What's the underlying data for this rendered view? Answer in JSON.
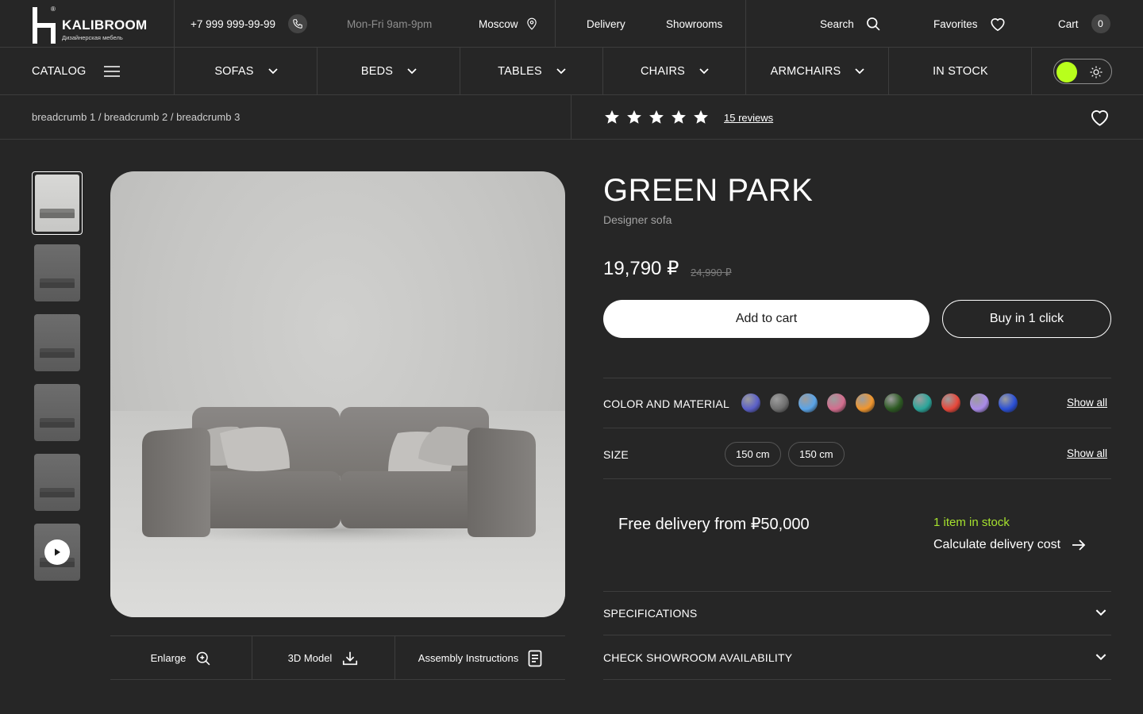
{
  "brand": {
    "name": "KALIBROOM",
    "tagline": "Дизайнерская мебель",
    "trademark": "®"
  },
  "header": {
    "phone": "+7 999 999-99-99",
    "hours": "Mon-Fri 9am-9pm",
    "city": "Moscow",
    "links": [
      "Delivery",
      "Showrooms"
    ],
    "search_label": "Search",
    "favorites_label": "Favorites",
    "cart_label": "Cart",
    "cart_count": "0"
  },
  "nav": {
    "catalog": "CATALOG",
    "categories": [
      "SOFAS",
      "BEDS",
      "TABLES",
      "CHAIRS",
      "ARMCHAIRS"
    ],
    "in_stock": "IN STOCK"
  },
  "theme": {
    "accent": "#b8ff1c",
    "in_stock_color": "#a6e22e"
  },
  "breadcrumb": "breadcrumb 1 / breadcrumb 2 / breadcrumb 3",
  "rating": {
    "stars": 5,
    "reviews": "15 reviews"
  },
  "product": {
    "title": "GREEN PARK",
    "subtitle": "Designer sofa",
    "price": "19,790 ₽",
    "old_price": "24,990 ₽",
    "add_to_cart": "Add to cart",
    "buy_one_click": "Buy in 1 click",
    "color_label": "COLOR AND MATERIAL",
    "size_label": "SIZE",
    "show_all": "Show all",
    "sizes": [
      "150 cm",
      "150 cm"
    ],
    "delivery_text": "Free delivery from ₽50,000",
    "stock_text": "1 item in stock",
    "calc_delivery": "Calculate delivery cost",
    "accordion": [
      "SPECIFICATIONS",
      "CHECK SHOWROOM AVAILABILITY"
    ]
  },
  "swatches": [
    "#5a5fc8",
    "#6f6f6f",
    "#5aa4e8",
    "#d36d8e",
    "#f0962e",
    "#2c5a22",
    "#2aa59a",
    "#e8473a",
    "#a98ae8",
    "#2a4fd6"
  ],
  "media_actions": [
    "Enlarge",
    "3D Model",
    "Assembly Instructions"
  ]
}
